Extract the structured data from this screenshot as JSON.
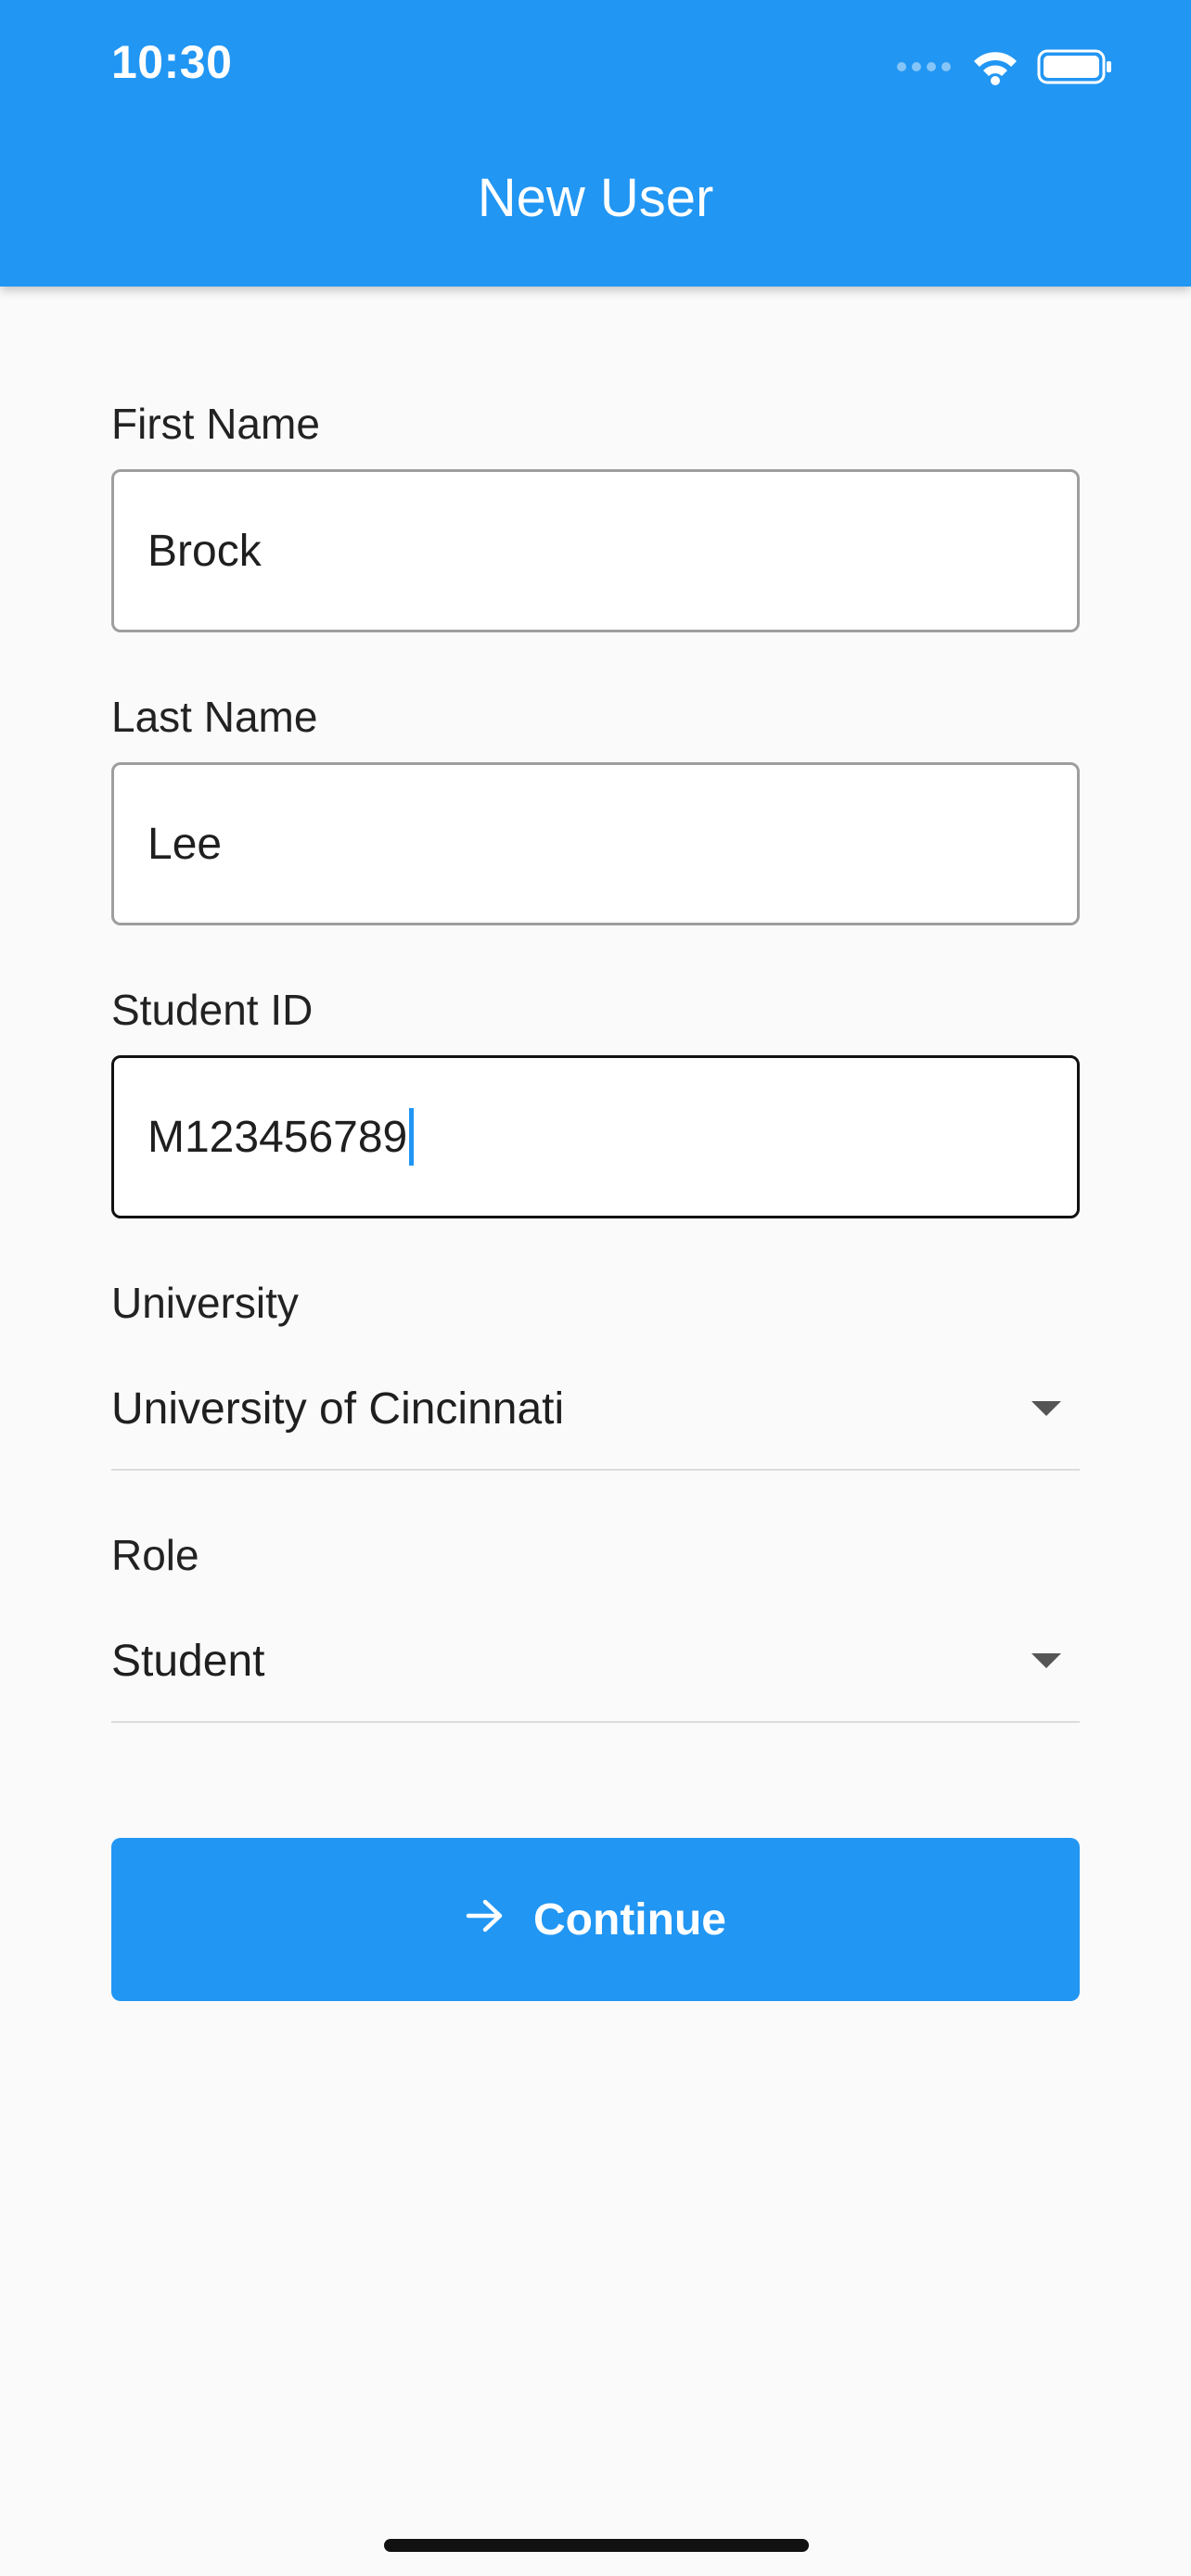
{
  "status_bar": {
    "time": "10:30",
    "icons": [
      "signal-dots-icon",
      "wifi-icon",
      "battery-icon"
    ]
  },
  "app_bar": {
    "title": "New User",
    "color": "#2196f3"
  },
  "form": {
    "first_name": {
      "label": "First Name",
      "value": "Brock"
    },
    "last_name": {
      "label": "Last Name",
      "value": "Lee"
    },
    "student_id": {
      "label": "Student ID",
      "value": "M123456789"
    },
    "university": {
      "label": "University",
      "selected": "University of Cincinnati"
    },
    "role": {
      "label": "Role",
      "selected": "Student"
    }
  },
  "continue_button": {
    "label": "Continue",
    "icon": "arrow-right-icon"
  }
}
